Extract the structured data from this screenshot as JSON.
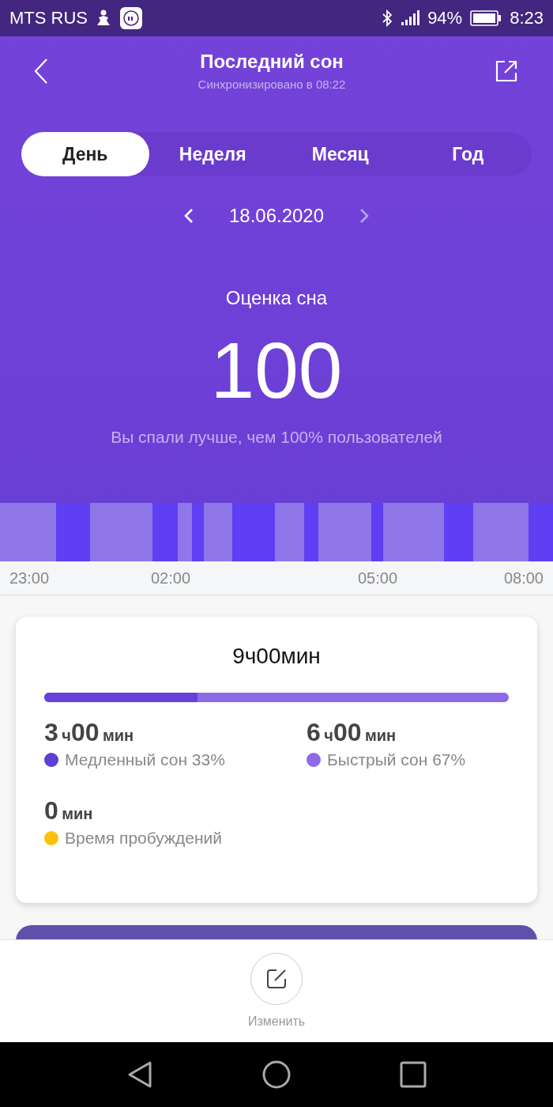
{
  "status_bar": {
    "carrier": "MTS RUS",
    "battery": "94%",
    "time": "8:23"
  },
  "header": {
    "title": "Последний сон",
    "subtitle": "Синхронизировано в 08:22"
  },
  "tabs": [
    {
      "label": "День",
      "selected": true
    },
    {
      "label": "Неделя",
      "selected": false
    },
    {
      "label": "Месяц",
      "selected": false
    },
    {
      "label": "Год",
      "selected": false
    }
  ],
  "date": "18.06.2020",
  "score": {
    "label": "Оценка сна",
    "value": "100",
    "comparison": "Вы спали лучше, чем 100% пользователей"
  },
  "timeline": {
    "ticks": [
      "23:00",
      "02:00",
      "05:00",
      "08:00"
    ]
  },
  "summary": {
    "total": "9ч00мин",
    "deep_share": {
      "level": 0.33
    },
    "stats": [
      {
        "hours": "3",
        "h_unit": "ч",
        "minutes": "00",
        "m_unit": "мин",
        "label": "Медленный сон 33%",
        "color": "#5f3dd6"
      },
      {
        "hours": "6",
        "h_unit": "ч",
        "minutes": "00",
        "m_unit": "мин",
        "label": "Быстрый сон 67%",
        "color": "#8d6be6"
      },
      {
        "minutes": "0",
        "m_unit": "мин",
        "label": "Время пробуждений",
        "color": "#ffc107"
      }
    ]
  },
  "edit_button": {
    "label": "Изменить"
  }
}
